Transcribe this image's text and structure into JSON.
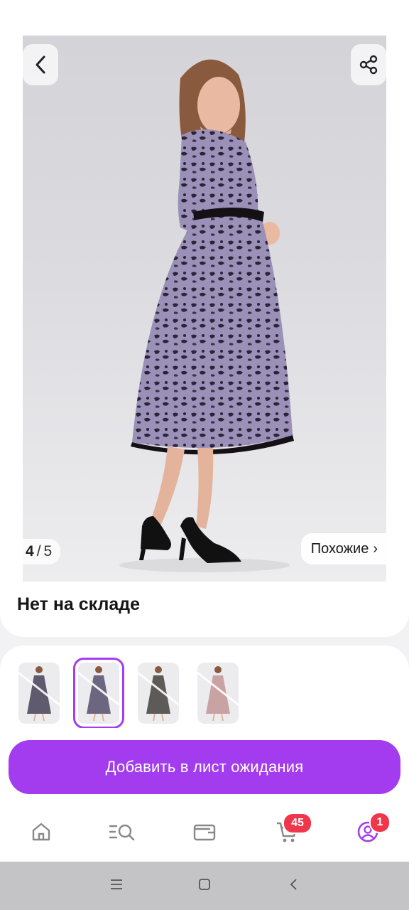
{
  "gallery": {
    "current": "4",
    "separator": "/",
    "total": "5",
    "similar_label": "Похожие",
    "similar_chevron": "›",
    "icons": {
      "back": "chevron-left-icon",
      "share": "share-icon"
    }
  },
  "product": {
    "stock_status": "Нет на складе"
  },
  "thumbnails": [
    {
      "selected": false,
      "dress_color": "#5f5a6e"
    },
    {
      "selected": true,
      "dress_color": "#6c6680"
    },
    {
      "selected": false,
      "dress_color": "#5d5a58"
    },
    {
      "selected": false,
      "dress_color": "#c9a3a3"
    }
  ],
  "actions": {
    "waitlist_label": "Добавить в лист ожидания",
    "accent": "#a33cef"
  },
  "bottom_nav": {
    "items": [
      {
        "name": "home",
        "icon": "home-icon"
      },
      {
        "name": "catalog",
        "icon": "catalog-search-icon"
      },
      {
        "name": "wallet",
        "icon": "wallet-icon"
      },
      {
        "name": "cart",
        "icon": "cart-icon",
        "badge": "45"
      },
      {
        "name": "profile",
        "icon": "profile-icon",
        "badge": "1"
      }
    ],
    "badge_color": "#f0364a"
  },
  "system_nav": {
    "icons": [
      "menu-icon",
      "home-square-icon",
      "back-icon"
    ]
  }
}
